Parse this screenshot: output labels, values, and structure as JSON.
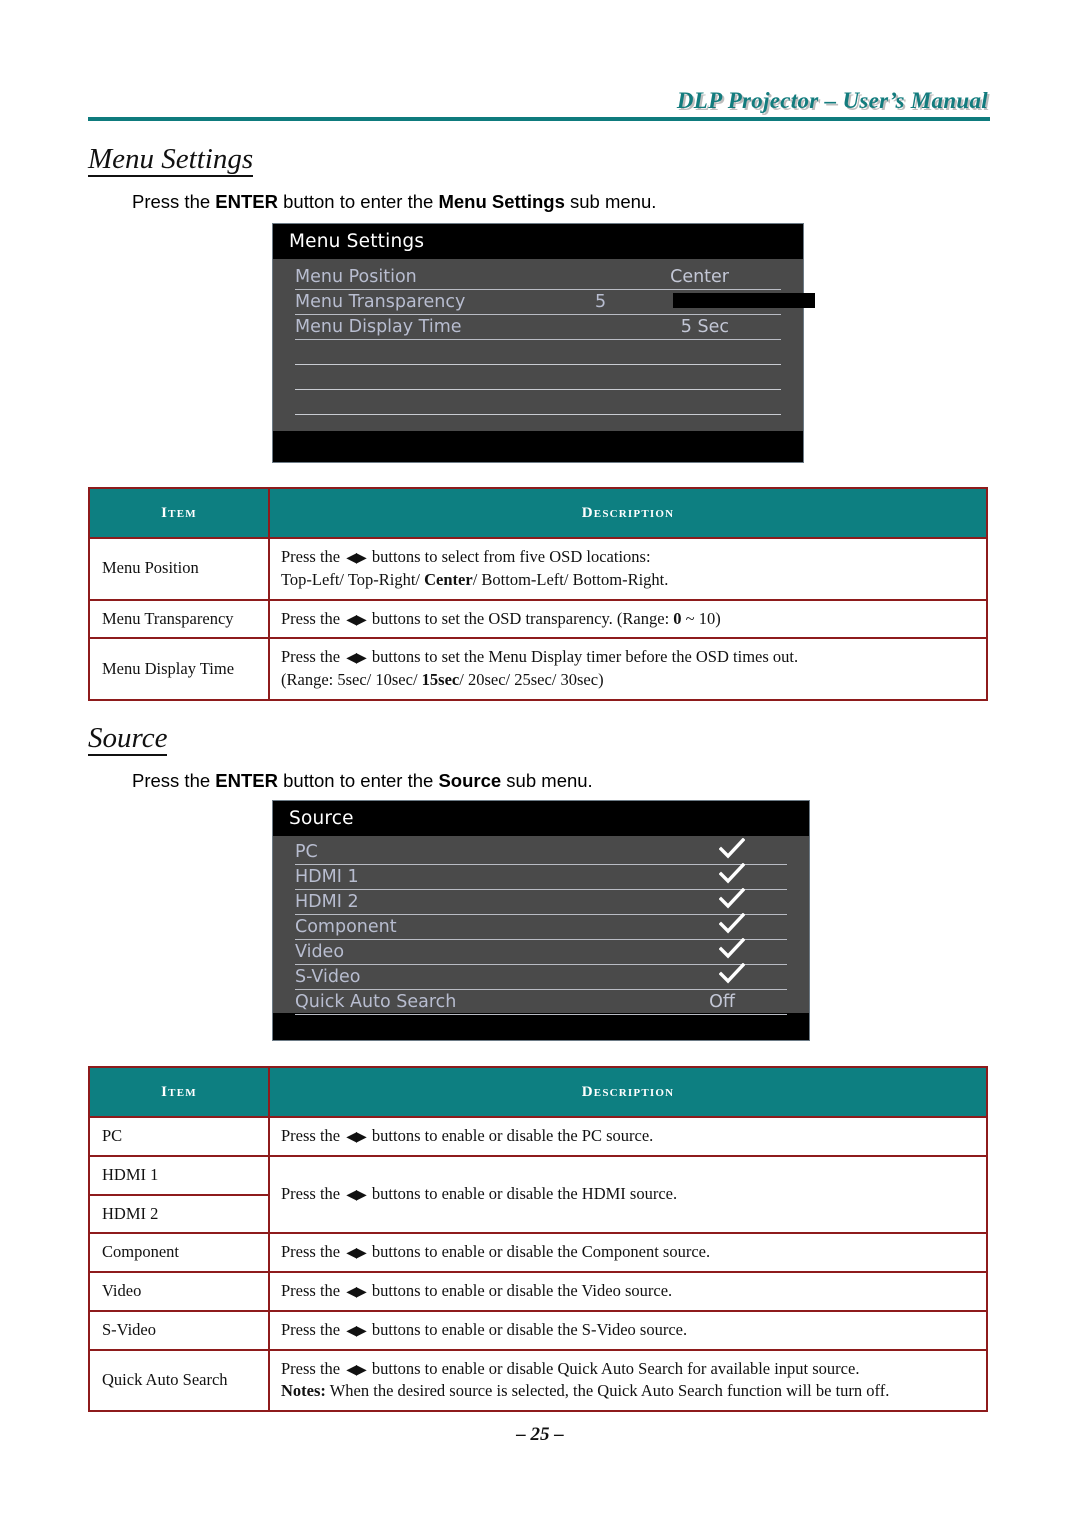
{
  "header": {
    "manual_title": "DLP Projector – User’s Manual"
  },
  "sections": [
    {
      "heading": "Menu Settings",
      "intro": {
        "prefix": "Press the ",
        "key": "ENTER",
        "middle": " button to enter the ",
        "target": "Menu Settings",
        "suffix": " sub menu."
      },
      "osd": {
        "title": "Menu Settings",
        "rows": [
          {
            "label": "Menu Position",
            "value": "Center",
            "type": "value"
          },
          {
            "label": "Menu Transparency",
            "number": "5",
            "slider_percent": 50,
            "type": "slider"
          },
          {
            "label": "Menu Display Time",
            "value": "5 Sec",
            "type": "value"
          },
          {
            "label": "",
            "type": "blank"
          },
          {
            "label": "",
            "type": "blank"
          },
          {
            "label": "",
            "type": "blank"
          }
        ]
      },
      "table": {
        "headers": {
          "item": "Item",
          "description": "Description"
        },
        "rows": [
          {
            "item": "Menu Position",
            "lines": [
              {
                "pre": "Press the ",
                "arrows": "◀▶",
                "post": " buttons to select from five OSD locations:"
              },
              {
                "pre": "Top-Left/ Top-Right/ ",
                "bold": "Center",
                "post": "/ Bottom-Left/ Bottom-Right."
              }
            ]
          },
          {
            "item": "Menu Transparency",
            "lines": [
              {
                "pre": "Press the ",
                "arrows": "◀▶",
                "post": " buttons to set the OSD transparency. (Range: ",
                "bold2": "0",
                "post2": " ~ 10)"
              }
            ]
          },
          {
            "item": "Menu Display Time",
            "lines": [
              {
                "pre": "Press the ",
                "arrows": "◀▶",
                "post": " buttons to set the Menu Display timer before the OSD times out."
              },
              {
                "pre": "(Range: 5sec/ 10sec/ ",
                "bold": "15sec",
                "post": "/ 20sec/ 25sec/ 30sec)"
              }
            ]
          }
        ]
      }
    },
    {
      "heading": "Source",
      "intro": {
        "prefix": "Press the ",
        "key": "ENTER",
        "middle": " button to enter the ",
        "target": "Source",
        "suffix": " sub menu."
      },
      "osd": {
        "title": "Source",
        "rows": [
          {
            "label": "PC",
            "type": "check",
            "icon": "check-icon"
          },
          {
            "label": "HDMI 1",
            "type": "check",
            "icon": "check-icon"
          },
          {
            "label": "HDMI 2",
            "type": "check",
            "icon": "check-icon"
          },
          {
            "label": "Component",
            "type": "check",
            "icon": "check-icon"
          },
          {
            "label": "Video",
            "type": "check",
            "icon": "check-icon"
          },
          {
            "label": "S-Video",
            "type": "check",
            "icon": "check-icon"
          },
          {
            "label": "Quick Auto Search",
            "value": "Off",
            "type": "value"
          }
        ]
      },
      "table": {
        "headers": {
          "item": "Item",
          "description": "Description"
        },
        "rows": [
          {
            "item": "PC",
            "desc_plain_pre": "Press the ",
            "arrows": "◀▶",
            "desc_plain_post": " buttons to enable or disable the PC source."
          },
          {
            "item": "HDMI 1",
            "merged_with_next": true,
            "desc_plain_pre": "Press the ",
            "arrows": "◀▶",
            "desc_plain_post": " buttons to enable or disable the HDMI source."
          },
          {
            "item": "HDMI 2"
          },
          {
            "item": "Component",
            "desc_plain_pre": "Press the ",
            "arrows": "◀▶",
            "desc_plain_post": " buttons to enable or disable the Component source."
          },
          {
            "item": "Video",
            "desc_plain_pre": "Press the ",
            "arrows": "◀▶",
            "desc_plain_post": " buttons to enable or disable the Video source."
          },
          {
            "item": "S-Video",
            "desc_plain_pre": "Press the ",
            "arrows": "◀▶",
            "desc_plain_post": " buttons to enable or disable the S-Video source."
          },
          {
            "item": "Quick Auto Search",
            "desc_plain_pre": "Press the ",
            "arrows": "◀▶",
            "desc_plain_post": " buttons to enable or disable Quick Auto Search for available input source.",
            "note_label": "Notes:",
            "note_text": " When the desired source is selected, the Quick Auto Search function will be turn off."
          }
        ]
      }
    }
  ],
  "footer": {
    "page_number": "– 25 –"
  },
  "colors": {
    "teal": "#0d7f81",
    "table_border_red": "#8e1b1c",
    "osd_body": "#4a4a4a",
    "osd_text": "#b8bdd0",
    "slider_fill": "#c9ec9b"
  }
}
